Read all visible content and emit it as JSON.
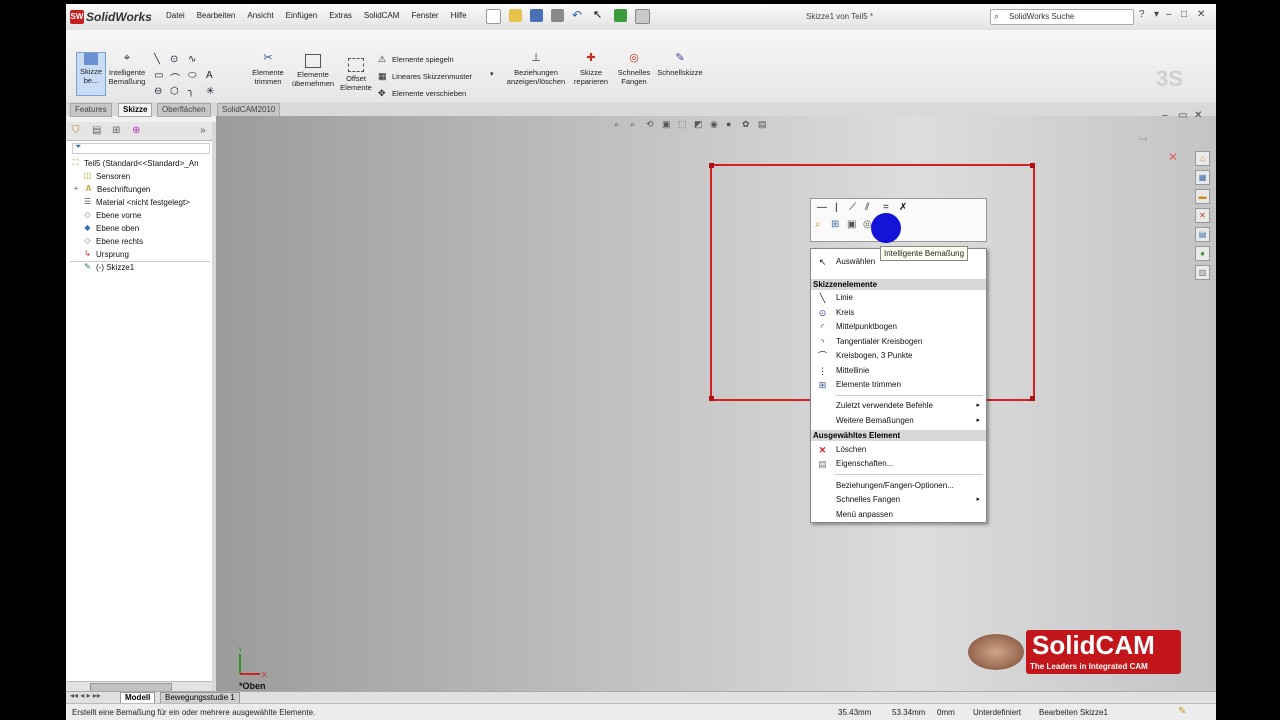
{
  "app": {
    "logo_text": "SolidWorks",
    "doc_title": "Skizze1 von Teil5 *",
    "search_placeholder": "SolidWorks Suche"
  },
  "menubar": [
    "Datei",
    "Bearbeiten",
    "Ansicht",
    "Einfügen",
    "Extras",
    "SolidCAM",
    "Fenster",
    "Hilfe"
  ],
  "command_manager": {
    "sketch_exit": "Skizze be...",
    "smart_dim": "Intelligente Bemaßung",
    "trim": "Elemente trimmen",
    "convert": "Elemente übernehmen",
    "offset": "Offset Elemente",
    "mirror": "Elemente spiegeln",
    "linear_pattern": "Lineares Skizzenmuster",
    "move": "Elemente verschieben",
    "relations": "Beziehungen anzeigen/löschen",
    "repair": "Skizze reparieren",
    "quick_snaps": "Schnelles Fangen",
    "rapid_sketch": "Schnellskizze"
  },
  "tabs": [
    "Features",
    "Skizze",
    "Oberflächen",
    "SolidCAM2010"
  ],
  "active_tab": "Skizze",
  "feature_tree": [
    {
      "label": "Teil5  (Standard<<Standard>_An",
      "icon": "part-icon"
    },
    {
      "label": "Sensoren",
      "icon": "sensor-icon"
    },
    {
      "label": "Beschriftungen",
      "icon": "annotation-icon"
    },
    {
      "label": "Material <nicht festgelegt>",
      "icon": "material-icon"
    },
    {
      "label": "Ebene vorne",
      "icon": "plane-icon"
    },
    {
      "label": "Ebene oben",
      "icon": "plane-icon"
    },
    {
      "label": "Ebene rechts",
      "icon": "plane-icon"
    },
    {
      "label": "Ursprung",
      "icon": "origin-icon"
    },
    {
      "label": "(-) Skizze1",
      "icon": "sketch-icon"
    }
  ],
  "context_menu": {
    "tooltip": "Intelligente Bemaßung",
    "select": "Auswählen",
    "section_sketch": "Skizzenelemente",
    "sketch_items": [
      "Linie",
      "Kreis",
      "Mittelpunktbogen",
      "Tangentialer Kreisbogen",
      "Kreisbogen, 3 Punkte",
      "Mittellinie",
      "Elemente trimmen"
    ],
    "recent": "Zuletzt verwendete Befehle",
    "more_dims": "Weitere Bemaßungen",
    "section_selected": "Ausgewähltes Element",
    "delete": "Löschen",
    "properties": "Eigenschaften...",
    "relations_options": "Beziehungen/Fangen-Optionen...",
    "quick_snaps": "Schnelles Fangen",
    "customize": "Menü anpassen"
  },
  "viewport": {
    "view_label": "*Oben",
    "axis_x": "X",
    "axis_y": "Y"
  },
  "branding": {
    "name": "SolidCAM",
    "tagline": "The Leaders in Integrated CAM"
  },
  "bottom_tabs": [
    "Modell",
    "Bewegungsstudie 1"
  ],
  "status": {
    "message": "Erstellt eine Bemaßung für ein oder mehrere ausgewählte Elemente.",
    "x": "35.43mm",
    "y": "53.34mm",
    "z": "0mm",
    "state": "Unterdefiniert",
    "mode": "Bearbeiten Skizze1"
  },
  "colors": {
    "sketch_red": "#d42020",
    "brand_red": "#c3161a",
    "cursor_blue": "#1414d8"
  }
}
